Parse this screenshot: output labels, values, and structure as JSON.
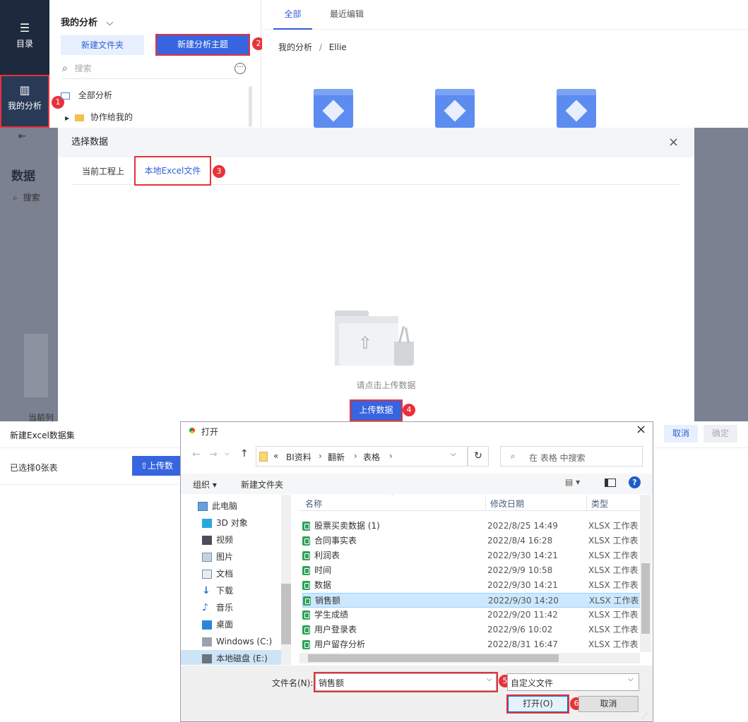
{
  "p1": {
    "nav": {
      "catalog": "目录",
      "my_analysis": "我的分析"
    },
    "side": {
      "title": "我的分析",
      "new_folder": "新建文件夹",
      "new_subject": "新建分析主题",
      "search_placeholder": "搜索",
      "tree_all": "全部分析",
      "tree_shared": "协作给我的"
    },
    "main": {
      "tab_all": "全部",
      "tab_recent": "最近编辑",
      "breadcrumb_root": "我的分析",
      "breadcrumb_sep": "/",
      "breadcrumb_current": "Ellie"
    },
    "badges": [
      "1",
      "2"
    ]
  },
  "p2": {
    "bg": {
      "title": "数据",
      "search": "搜索",
      "current_label": "当前列"
    },
    "dialog": {
      "title": "选择数据",
      "tab_project": "当前工程上",
      "tab_excel": "本地Excel文件",
      "hint": "请点击上传数据",
      "upload_btn": "上传数据"
    },
    "badges": [
      "3",
      "4"
    ]
  },
  "p3": {
    "bg": {
      "title": "新建Excel数据集",
      "selected": "已选择0张表",
      "upload_btn": "上传数",
      "cancel": "取消",
      "confirm": "确定"
    },
    "fd": {
      "title": "打开",
      "path": [
        "BI资料",
        "翻新",
        "表格"
      ],
      "path_prefix": "«",
      "search_placeholder": "在 表格 中搜索",
      "organize": "组织 ▾",
      "new_folder": "新建文件夹",
      "col_name": "名称",
      "col_date": "修改日期",
      "col_type": "类型",
      "tree": [
        "此电脑",
        "3D 对象",
        "视频",
        "图片",
        "文档",
        "下载",
        "音乐",
        "桌面",
        "Windows (C:)",
        "本地磁盘 (E:)"
      ],
      "rows": [
        {
          "name": "股票买卖数据 (1)",
          "date": "2022/8/25 14:49",
          "type": "XLSX 工作表"
        },
        {
          "name": "合同事实表",
          "date": "2022/8/4 16:28",
          "type": "XLSX 工作表"
        },
        {
          "name": "利润表",
          "date": "2022/9/30 14:21",
          "type": "XLSX 工作表"
        },
        {
          "name": "时间",
          "date": "2022/9/9 10:58",
          "type": "XLSX 工作表"
        },
        {
          "name": "数据",
          "date": "2022/9/30 14:21",
          "type": "XLSX 工作表"
        },
        {
          "name": "销售额",
          "date": "2022/9/30 14:20",
          "type": "XLSX 工作表"
        },
        {
          "name": "学生成绩",
          "date": "2022/9/20 11:42",
          "type": "XLSX 工作表"
        },
        {
          "name": "用户登录表",
          "date": "2022/9/6 10:02",
          "type": "XLSX 工作表"
        },
        {
          "name": "用户留存分析",
          "date": "2022/8/31 16:47",
          "type": "XLSX 工作表"
        }
      ],
      "filename_label": "文件名(N):",
      "filename_value": "销售额",
      "filter": "自定义文件",
      "open_btn": "打开(O)",
      "cancel_btn": "取消"
    },
    "badges": [
      "5",
      "6"
    ]
  }
}
